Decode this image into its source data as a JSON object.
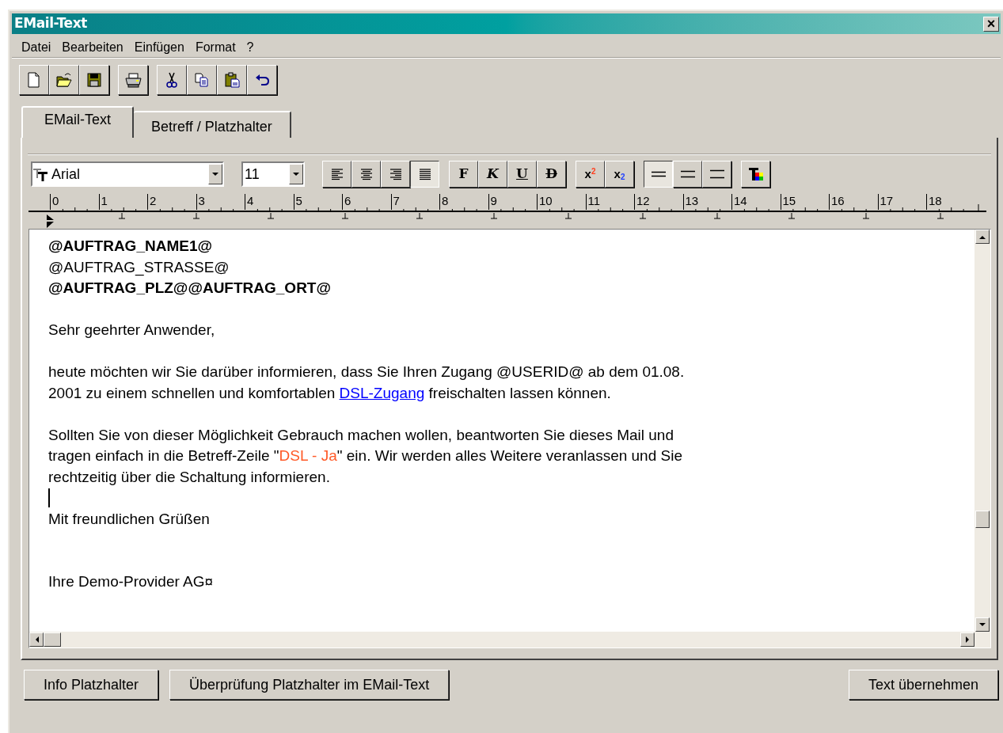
{
  "window": {
    "title": "EMail-Text",
    "close": "×"
  },
  "menu": [
    "Datei",
    "Bearbeiten",
    "Einfügen",
    "Format",
    "?"
  ],
  "toolbar": [
    [
      {
        "kind": "new"
      },
      {
        "kind": "open"
      },
      {
        "kind": "save"
      }
    ],
    [
      {
        "kind": "print"
      }
    ],
    [
      {
        "kind": "cut"
      },
      {
        "kind": "copy"
      },
      {
        "kind": "paste"
      },
      {
        "kind": "undo"
      }
    ]
  ],
  "tabs": [
    {
      "label": "EMail-Text",
      "selected": true
    },
    {
      "label": "Betreff / Platzhalter",
      "selected": false
    }
  ],
  "format_bar": {
    "font": "Arial",
    "size": "11",
    "align": [
      {
        "kind": "left",
        "selected": false
      },
      {
        "kind": "center",
        "selected": false
      },
      {
        "kind": "right",
        "selected": false
      },
      {
        "kind": "justify",
        "selected": true
      }
    ],
    "styles": [
      {
        "kind": "bold",
        "label": "F"
      },
      {
        "kind": "italic",
        "label": "K"
      },
      {
        "kind": "underline",
        "label": "U"
      },
      {
        "kind": "strike",
        "label": "D"
      }
    ],
    "scripts": [
      {
        "kind": "sup",
        "label": "x$^{2}$"
      },
      {
        "kind": "sub",
        "label": "x$_{2}$"
      }
    ],
    "spacing": [
      {
        "kind": "single",
        "selected": true
      },
      {
        "kind": "onehalf",
        "selected": false
      },
      {
        "kind": "double",
        "selected": false
      }
    ]
  },
  "ruler": [
    "0",
    "1",
    "2",
    "3",
    "4",
    "5",
    "6",
    "7",
    "8",
    "9",
    "10",
    "11",
    "12",
    "13",
    "14",
    "15",
    "16",
    "17",
    "18"
  ],
  "editor": [
    {
      "kind": "line",
      "bold": true,
      "text": "@AUFTRAG_NAME1@"
    },
    {
      "kind": "line",
      "bold": false,
      "text": "@AUFTRAG_STRASSE@"
    },
    {
      "kind": "line",
      "bold": true,
      "text": "@AUFTRAG_PLZ@@AUFTRAG_ORT@"
    },
    {
      "kind": "blank"
    },
    {
      "kind": "line",
      "bold": false,
      "text": "Sehr geehrter Anwender,"
    },
    {
      "kind": "blank"
    },
    {
      "kind": "paragraph",
      "lines": [
        [
          {
            "kind": "text",
            "text": "heute möchten wir Sie darüber informieren, dass Sie Ihren Zugang @USERID@ ab dem 01.08."
          }
        ],
        [
          {
            "kind": "text",
            "text": "2001 zu einem schnellen und komfortablen "
          },
          {
            "kind": "link",
            "text": "DSL-Zugang"
          },
          {
            "kind": "text",
            "text": " freischalten lassen können."
          }
        ]
      ]
    },
    {
      "kind": "blank"
    },
    {
      "kind": "paragraph",
      "lines": [
        [
          {
            "kind": "text",
            "text": "Sollten Sie von dieser Möglichkeit Gebrauch machen wollen, beantworten Sie dieses Mail und"
          }
        ],
        [
          {
            "kind": "text",
            "text": "tragen einfach in die Betreff-Zeile \""
          },
          {
            "kind": "highlight",
            "text": "DSL - Ja"
          },
          {
            "kind": "text",
            "text": "\" ein. Wir werden alles Weitere veranlassen und Sie"
          }
        ],
        [
          {
            "kind": "text",
            "text": "rechtzeitig über die Schaltung informieren."
          }
        ]
      ]
    },
    {
      "kind": "cursor"
    },
    {
      "kind": "line",
      "bold": false,
      "text": "Mit freundlichen Grüßen"
    },
    {
      "kind": "blank"
    },
    {
      "kind": "blank"
    },
    {
      "kind": "line",
      "bold": false,
      "text": "Ihre Demo-Provider AG¤"
    }
  ],
  "buttons": {
    "left": [
      "Info Platzhalter",
      "Überprüfung Platzhalter im EMail-Text"
    ],
    "right": [
      "Text übernehmen"
    ]
  }
}
